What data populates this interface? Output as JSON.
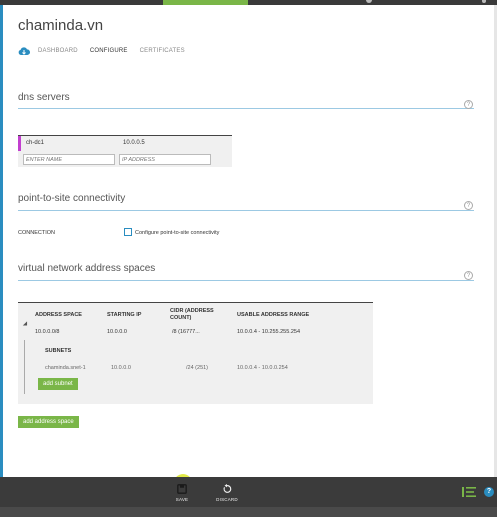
{
  "app": {
    "title": "chaminda.vn"
  },
  "nav": {
    "tabs": [
      {
        "label": "DASHBOARD",
        "active": false
      },
      {
        "label": "CONFIGURE",
        "active": true
      },
      {
        "label": "CERTIFICATES",
        "active": false
      }
    ]
  },
  "sections": {
    "dns": {
      "title": "dns servers",
      "servers": [
        {
          "name": "ch-dc1",
          "ip": "10.0.0.5"
        }
      ],
      "name_placeholder": "ENTER NAME",
      "ip_placeholder": "IP ADDRESS"
    },
    "p2s": {
      "title": "point-to-site connectivity",
      "connection_label": "CONNECTION",
      "checkbox_label": "Configure point-to-site connectivity",
      "checked": false
    },
    "vnet": {
      "title": "virtual network address spaces",
      "headers": {
        "address_space": "ADDRESS SPACE",
        "starting_ip": "STARTING IP",
        "cidr_1": "CIDR (ADDRESS",
        "cidr_2": "COUNT)",
        "usable_range": "USABLE ADDRESS RANGE"
      },
      "address_spaces": [
        {
          "address_space": "10.0.0.0/8",
          "starting_ip": "10.0.0.0",
          "cidr": "/8 (16777...",
          "usable_range": "10.0.0.4 - 10.255.255.254"
        }
      ],
      "subnets_label": "SUBNETS",
      "subnets": [
        {
          "name": "chaminda.snet-1",
          "starting_ip": "10.0.0.0",
          "cidr": "/24 (251)",
          "usable_range": "10.0.0.4 - 10.0.0.254"
        }
      ],
      "add_subnet_label": "add subnet",
      "add_address_space_label": "add address space"
    }
  },
  "help_glyph": "?",
  "commandbar": {
    "save_label": "SAVE",
    "discard_label": "DISCARD",
    "help_glyph": "?",
    "icons": [
      "save-icon",
      "discard-icon",
      "activity-list-icon",
      "help-icon"
    ]
  },
  "colors": {
    "accent_green": "#7ab648",
    "accent_blue": "#2a8dc0",
    "selected_marker": "#c23fcf",
    "bar_dark": "#3b3b3b",
    "save_highlight": "#dce628"
  }
}
